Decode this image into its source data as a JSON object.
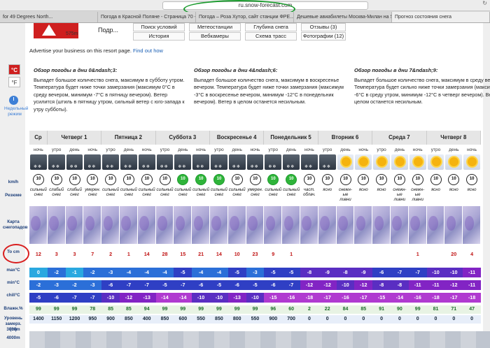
{
  "browser": {
    "url": "ru.snow-forecast.com",
    "tabs": [
      "for 49 Degrees North...",
      "Погода в Красной Поляне - Страница 70 - К...",
      "Погода – Роза Хутор, сайт станции ФРЕ...",
      "Дешевые авиабилеты Москва-Милан на S...",
      "Прогноз состояния снега"
    ]
  },
  "site": {
    "altitudes": [
      "144m",
      "575m"
    ],
    "resort_short": "Подр...",
    "nav": [
      "Поиск условий",
      "Метеостанции",
      "Глубина снега",
      "Отзывы (3)",
      "История",
      "Вебкамеры",
      "Схема трасс",
      "Фотографии (12)"
    ],
    "advert_text": "Advertise your business on this resort page.",
    "advert_link": "Find out how"
  },
  "units": {
    "c": "°C",
    "f": "°F",
    "weekly_label": "Недельный режим"
  },
  "summaries": [
    {
      "title": "Обзор погоды в дни 0&ndash;3:",
      "text": "Выпадет большое количество снега, максимум в субботу утром. Температура будет ниже точки замерзания (максимум 0°C в среду вечером, минимум -7°C в пятницу вечером). Ветер усилится (штиль в пятницу утром, сильный ветер с юго-запада к утру субботы)."
    },
    {
      "title": "Обзор погоды в дни 4&ndash;6:",
      "text": "Выпадет большое количество снега, максимум в воскресенье вечером. Температура будет ниже точки замерзания (максимум -3°C в воскресенье вечером, минимум -12°C в понедельник вечером). Ветер в целом останется несильным."
    },
    {
      "title": "Обзор погоды в дни 7&ndash;9:",
      "text": "Выпадет большое количество снега, максимум в среду вечером. Температура будет сильно ниже точки замерзания (максимум -6°C в среду утром, минимум -12°C в четверг вечером). Ветер в целом останется несильным."
    }
  ],
  "days": [
    "Ср",
    "Четверг 1",
    "Пятница 2",
    "Суббота 3",
    "Воскресенье 4",
    "Понедельник 5",
    "Вторник 6",
    "Среда 7",
    "Четверг 8"
  ],
  "times": [
    "ночь",
    "утро",
    "день",
    "ночь",
    "утро",
    "день",
    "ночь",
    "утро",
    "день",
    "ночь",
    "утро",
    "день",
    "ночь",
    "утро",
    "день",
    "ночь",
    "утро",
    "день",
    "ночь",
    "утро",
    "день",
    "ночь",
    "утро",
    "день",
    "ночь"
  ],
  "icon_types": [
    "snow",
    "snow",
    "snow",
    "snow",
    "snow",
    "snow",
    "snow",
    "snow",
    "snow",
    "snow",
    "snow",
    "snow",
    "snow",
    "snow",
    "snow",
    "snow",
    "snow",
    "sun",
    "sun",
    "sun",
    "sun",
    "sun",
    "sun",
    "sun",
    "sun"
  ],
  "wind": [
    "10",
    "10",
    "10",
    "10",
    "10",
    "10",
    "10",
    "10",
    "10",
    "10",
    "10",
    "10",
    "10",
    "10",
    "10",
    "10",
    "10",
    "10",
    "10",
    "10",
    "10",
    "10",
    "10",
    "10",
    "10"
  ],
  "wind_green": [
    false,
    false,
    false,
    false,
    false,
    false,
    false,
    false,
    true,
    true,
    true,
    false,
    false,
    true,
    true,
    false,
    false,
    false,
    false,
    false,
    false,
    false,
    false,
    false,
    false
  ],
  "summary_text": [
    "сильный снег",
    "слабый снег",
    "слабый снег",
    "умерен. снег",
    "сильный снег",
    "сильный снег",
    "сильный снег",
    "сильный снег",
    "сильный снег",
    "сильный снег",
    "сильный снег",
    "сильный снег",
    "умерен. снег",
    "сильный снег",
    "сильный снег",
    "част. облач.",
    "ясно",
    "снежн-ые ливни",
    "ясно",
    "ясно",
    "снежн-ые ливни",
    "снежн-ые ливни",
    "ясно",
    "ясно",
    "ясно"
  ],
  "row_labels": {
    "wind": "km/h",
    "summary": "Резюме",
    "map": "Карта снегопадов",
    "snow": "To cm",
    "max": "max°C",
    "min": "min°C",
    "chill": "chill°C",
    "hum": "Влажн.%",
    "freeze": "Уровень замерз. (m)",
    "lvl3000": "3000m",
    "lvl4000": "4000m"
  },
  "snow_cm": [
    "12",
    "3",
    "3",
    "7",
    "2",
    "1",
    "14",
    "28",
    "15",
    "21",
    "14",
    "10",
    "23",
    "9",
    "1",
    "",
    "",
    "",
    "",
    "",
    "",
    "1",
    "",
    "20",
    "4"
  ],
  "max_c": [
    "0",
    "-2",
    "-1",
    "-2",
    "-3",
    "-4",
    "-4",
    "-4",
    "-5",
    "-4",
    "-4",
    "-5",
    "-3",
    "-5",
    "-5",
    "-8",
    "-9",
    "-8",
    "-9",
    "-6",
    "-7",
    "-7",
    "-10",
    "-10",
    "-11"
  ],
  "min_c": [
    "-2",
    "-3",
    "-2",
    "-3",
    "-6",
    "-7",
    "-7",
    "-5",
    "-7",
    "-6",
    "-5",
    "-6",
    "-5",
    "-6",
    "-7",
    "-12",
    "-12",
    "-10",
    "-12",
    "-8",
    "-8",
    "-11",
    "-11",
    "-12",
    "-11"
  ],
  "chill_c": [
    "-5",
    "-6",
    "-7",
    "-7",
    "-10",
    "-12",
    "-13",
    "-14",
    "-14",
    "-10",
    "-10",
    "-13",
    "-10",
    "-15",
    "-16",
    "-18",
    "-17",
    "-16",
    "-17",
    "-15",
    "-14",
    "-16",
    "-18",
    "-17",
    "-18"
  ],
  "humidity": [
    "99",
    "99",
    "99",
    "78",
    "85",
    "85",
    "94",
    "99",
    "99",
    "99",
    "99",
    "99",
    "99",
    "96",
    "60",
    "2",
    "22",
    "84",
    "85",
    "91",
    "90",
    "99",
    "81",
    "71",
    "47"
  ],
  "freeze_m": [
    "1400",
    "1150",
    "1200",
    "950",
    "900",
    "850",
    "400",
    "850",
    "600",
    "550",
    "850",
    "800",
    "550",
    "900",
    "700",
    "0",
    "0",
    "0",
    "0",
    "0",
    "0",
    "0",
    "0",
    "0",
    "0"
  ],
  "colors": {
    "red": "#d91e1e",
    "green": "#1b9b2e",
    "blue_link": "#1a5fb4"
  }
}
